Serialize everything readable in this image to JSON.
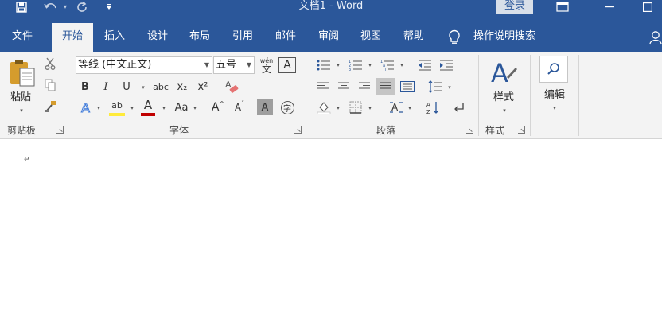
{
  "window": {
    "title": "文档1 - Word",
    "login_label": "登录"
  },
  "quick_access": {
    "icons": [
      "save-icon",
      "undo-icon",
      "redo-icon",
      "customize-qat-icon"
    ]
  },
  "tabs": [
    {
      "label": "文件",
      "active": false
    },
    {
      "label": "开始",
      "active": true
    },
    {
      "label": "插入",
      "active": false
    },
    {
      "label": "设计",
      "active": false
    },
    {
      "label": "布局",
      "active": false
    },
    {
      "label": "引用",
      "active": false
    },
    {
      "label": "邮件",
      "active": false
    },
    {
      "label": "审阅",
      "active": false
    },
    {
      "label": "视图",
      "active": false
    },
    {
      "label": "帮助",
      "active": false
    }
  ],
  "tell_me": {
    "label": "操作说明搜索",
    "icon": "lightbulb-icon"
  },
  "ribbon": {
    "clipboard": {
      "group_label": "剪贴板",
      "paste_label": "粘贴"
    },
    "font": {
      "group_label": "字体",
      "font_name": "等线 (中文正文)",
      "font_size": "五号",
      "wen_glyph": "wén",
      "wen_char": "文",
      "bold": "B",
      "italic": "I",
      "underline": "U",
      "strike": "abc",
      "subscript": "x₂",
      "superscript": "x²",
      "text_effect": "A",
      "highlight": "ab",
      "font_color": "A",
      "change_case": "Aa",
      "grow": "A",
      "shrink": "A",
      "char_shading": "A",
      "enclose": "字",
      "border_char": "A"
    },
    "paragraph": {
      "group_label": "段落"
    },
    "styles": {
      "group_label": "样式",
      "styles_label": "样式"
    },
    "editing": {
      "editing_label": "编辑"
    }
  },
  "document": {
    "paragraph_mark": "↵"
  },
  "colors": {
    "accent": "#2b579a",
    "ribbon_bg": "#f3f3f3",
    "highlight_yellow": "#ffeb3b",
    "font_red": "#c00000"
  }
}
